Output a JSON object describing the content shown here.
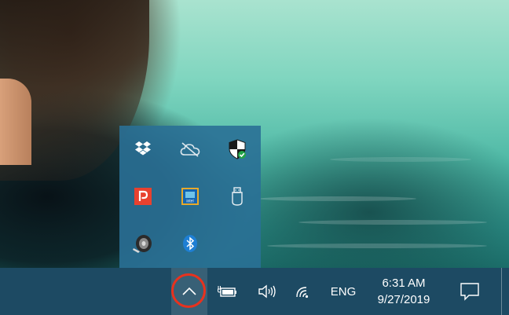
{
  "overflow_tray": {
    "icons": [
      {
        "name": "dropbox-icon"
      },
      {
        "name": "onedrive-offline-icon"
      },
      {
        "name": "windows-security-icon"
      },
      {
        "name": "pushbullet-icon"
      },
      {
        "name": "intel-graphics-icon",
        "text": "intel"
      },
      {
        "name": "safely-remove-usb-icon"
      },
      {
        "name": "speaker-audio-icon"
      },
      {
        "name": "bluetooth-icon"
      }
    ]
  },
  "taskbar": {
    "language": "ENG",
    "time": "6:31 AM",
    "date": "9/27/2019"
  },
  "colors": {
    "taskbar": "#1d4a63",
    "overflow_panel": "#2a7096",
    "highlight_circle": "#e8321e"
  }
}
